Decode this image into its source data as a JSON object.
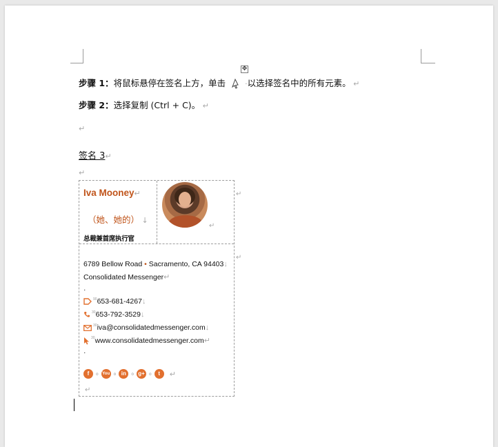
{
  "step1": {
    "label": "步骤 1：",
    "text_before": "将鼠标悬停在签名上方，单击",
    "text_after": "以选择签名中的所有元素。"
  },
  "step2": {
    "label": "步骤 2：",
    "text": "选择复制 (Ctrl + C)。"
  },
  "signature_heading": "签名 3",
  "signature": {
    "name": "Iva Mooney",
    "pronouns": "（她、她的）",
    "job_title": "总裁兼首席执行官",
    "address": "6789 Bellow Road",
    "city": "Sacramento, CA 94403",
    "company": "Consolidated Messenger",
    "phone1": "653-681-4267",
    "phone2": "653-792-3529",
    "email": "iva@consolidatedmessenger.com",
    "website": "www.consolidatedmessenger.com",
    "social": [
      "f",
      "You",
      "in",
      "g+",
      "t"
    ]
  },
  "colors": {
    "accent": "#c0541a",
    "icon": "#e2702f"
  },
  "icons": [
    "move-handle-icon",
    "mouse-pointer-icon",
    "tag-icon",
    "phone-icon",
    "mail-icon",
    "cursor-icon",
    "facebook-icon",
    "youtube-icon",
    "linkedin-icon",
    "google-plus-icon",
    "twitter-icon"
  ]
}
